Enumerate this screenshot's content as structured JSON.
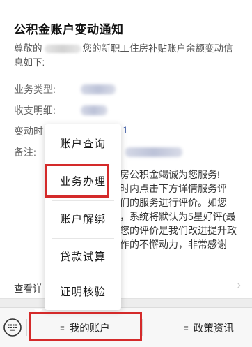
{
  "card": {
    "title": "公积金账户变动通知",
    "intro_prefix": "尊敬的",
    "intro_rest": "您的新职工住房补贴账户余额变动信息如下:",
    "fields": {
      "business_type_label": "业务类型:",
      "income_expense_label": "收支明细:",
      "change_time_label": "变动时",
      "change_time_partial": "1",
      "remarks_label": "备注:"
    },
    "body_lines": [
      "房公积金竭诚为您服务!",
      "时内点击下方详情服务评",
      "们的服务进行评价。如您",
      "，系统将默认为5星好评(最",
      "您的评价是我们改进提升政",
      "作的不懈动力，非常感谢"
    ],
    "view_details": "查看详",
    "chevron_icon": "chevron-right-icon"
  },
  "popup": {
    "items": [
      {
        "label": "账户查询"
      },
      {
        "label": "业务办理"
      },
      {
        "label": "账户解绑"
      },
      {
        "label": "贷款试算"
      },
      {
        "label": "证明核验"
      }
    ]
  },
  "menubar": {
    "keyboard_icon": "keyboard-icon",
    "tabs": [
      {
        "label": "我的账户",
        "icon": "hamburger-icon"
      },
      {
        "label": "政策资讯",
        "icon": "hamburger-icon"
      }
    ]
  },
  "colors": {
    "highlight": "#d42a2a",
    "background": "#ededed",
    "card": "#ffffff"
  }
}
